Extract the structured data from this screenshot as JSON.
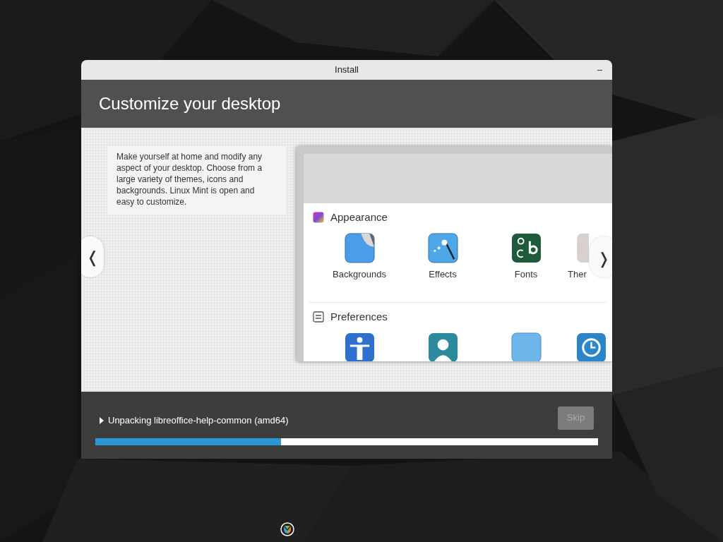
{
  "window": {
    "title": "Install",
    "minimize": "–"
  },
  "header": {
    "title": "Customize your desktop"
  },
  "slide": {
    "description": "Make yourself at home and modify any aspect of your desktop. Choose from a large variety of themes, icons and backgrounds. Linux Mint is open and easy to customize.",
    "prev": "❬",
    "next": "❭",
    "screenshot": {
      "sections": [
        {
          "kind": "appearance",
          "title": "Appearance",
          "items": [
            {
              "kind": "backgrounds",
              "label": "Backgrounds"
            },
            {
              "kind": "effects",
              "label": "Effects"
            },
            {
              "kind": "fonts",
              "label": "Fonts"
            },
            {
              "kind": "themes",
              "label": "Ther"
            }
          ]
        },
        {
          "kind": "preferences",
          "title": "Preferences",
          "items": [
            {
              "kind": "accessibility"
            },
            {
              "kind": "account"
            },
            {
              "kind": "blank"
            },
            {
              "kind": "clock"
            }
          ]
        }
      ]
    }
  },
  "progress": {
    "expanded": false,
    "text": "Unpacking libreoffice-help-common (amd64)",
    "level": 0.37,
    "skip": {
      "label": "Skip",
      "disabled": true
    }
  }
}
